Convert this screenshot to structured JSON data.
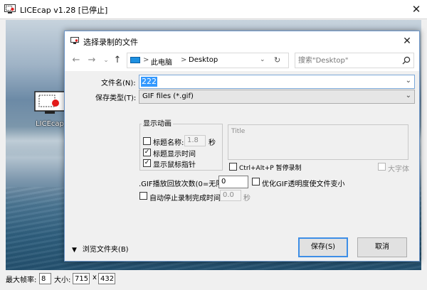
{
  "app": {
    "title": "LICEcap v1.28 [已停止]",
    "close_icon": "close-icon"
  },
  "desktop": {
    "icon_label": "LICEcap"
  },
  "status": {
    "max_fps_label": "最大帧率:",
    "max_fps_value": "8",
    "size_label": "大小:",
    "width": "715",
    "x_sep": "x",
    "height": "432"
  },
  "dialog": {
    "title": "选择录制的文件",
    "nav": {
      "back_icon": "arrow-left-icon",
      "forward_icon": "arrow-right-icon",
      "up_icon": "arrow-up-icon",
      "breadcrumb": [
        "此电脑",
        "Desktop"
      ],
      "separator": ">",
      "search_placeholder": "搜索\"Desktop\""
    },
    "filename_label": "文件名(N):",
    "filename_value": "222",
    "filetype_label": "保存类型(T):",
    "filetype_value": "GIF files (*.gif)",
    "group_title": "显示动画",
    "title_name_label": "标题名称:",
    "title_name_value": "1.8",
    "title_name_unit": "秒",
    "show_title_time_label": "标题显示时间",
    "show_cursor_label": "显示鼠标指针",
    "title_box_placeholder": "Title",
    "pause_label": "Ctrl+Alt+P 暂停录制",
    "large_font_label": "大字体",
    "loop_label": ".GIF播放回放次数(0=无限):",
    "loop_value": "0",
    "optimize_label": "优化GIF透明度使文件变小",
    "auto_stop_label": "自动停止录制完成时间:",
    "auto_stop_value": "0.0",
    "auto_stop_unit": "秒",
    "browse_label": "浏览文件夹(B)",
    "save_label": "保存(S)",
    "cancel_label": "取消",
    "checkboxes": {
      "title_name": false,
      "show_title_time": true,
      "show_cursor": true,
      "pause": false,
      "large_font": false,
      "optimize": false,
      "auto_stop": false
    }
  }
}
